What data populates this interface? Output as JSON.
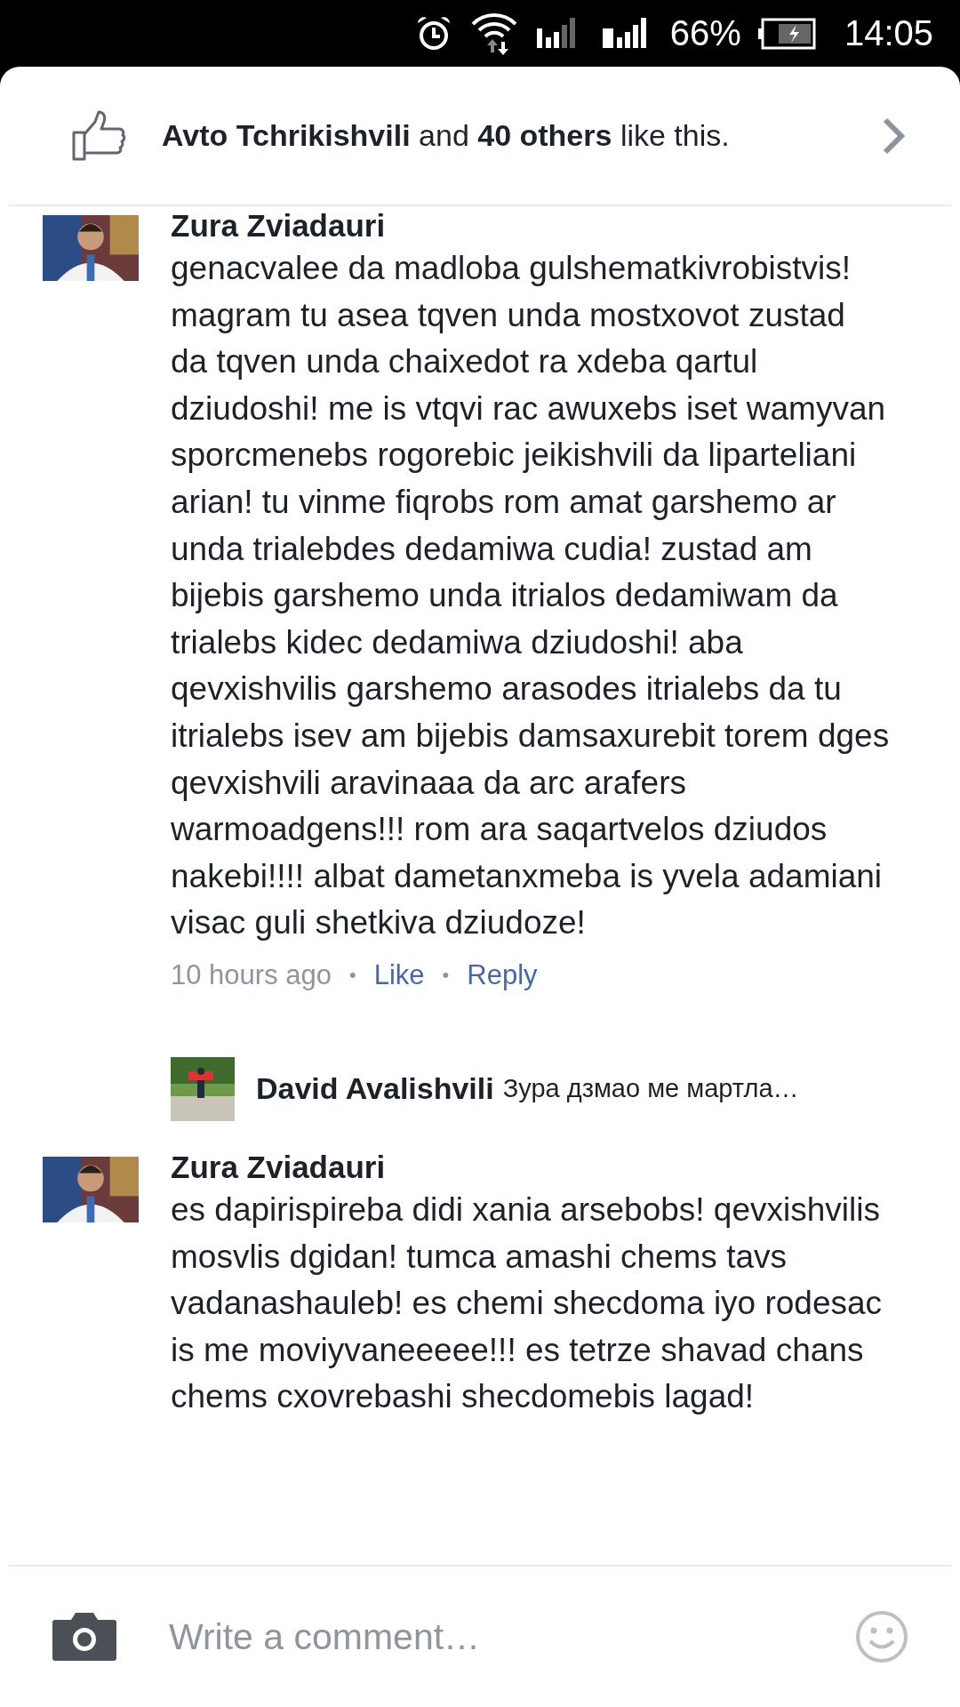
{
  "status_bar": {
    "battery": "66%",
    "time": "14:05"
  },
  "likes": {
    "text": "**Avto Tchrikishvili** and **40 others** like this."
  },
  "comments": [
    {
      "kind": "comment",
      "author": "Zura Zviadauri",
      "body": "genacvalee da madloba gulshematkivrobistvis! magram tu asea tqven unda mostxovot zustad da tqven unda chaixedot ra xdeba qartul dziudoshi! me is vtqvi rac awuxebs iset wamyvan sporcmenebs rogorebic jeikishvili da liparteliani arian! tu vinme fiqrobs rom amat garshemo ar unda trialebdes dedamiwa cudia! zustad am bijebis garshemo unda itrialos dedamiwam da trialebs kidec dedamiwa dziudoshi! aba qevxishvilis garshemo arasodes itrialebs da tu itrialebs isev am bijebis damsaxurebit torem dges qevxishvili aravinaaa da arc arafers warmoadgens!!! rom ara saqartvelos dziudos nakebi!!!! albat dametanxmeba is yvela adamiani visac guli shetkiva dziudoze!",
      "time": "10 hours ago",
      "actions": [
        "Like",
        "Reply"
      ],
      "separator": "•",
      "reply": {
        "author": "David Avalishvili",
        "preview": "Зура дзмао ме мартла…"
      }
    },
    {
      "kind": "comment",
      "author": "Zura Zviadauri",
      "body": "es dapirispireba didi xania arsebobs! qevxishvilis mosvlis dgidan! tumca amashi chems tavs vadanashauleb! es chemi shecdoma iyo rodesac is me moviyvaneeeee!!! es tetrze shavad chans chems cxovrebashi shecdomebis lagad!"
    }
  ],
  "composer": {
    "placeholder": "Write a comment…"
  }
}
